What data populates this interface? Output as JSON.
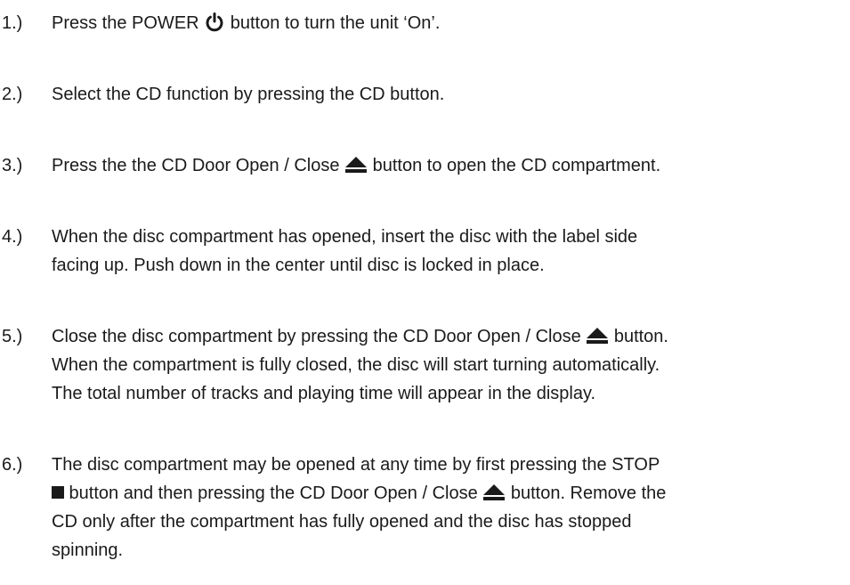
{
  "steps": [
    {
      "number": "1.)",
      "parts": [
        "Press the POWER ",
        " button to turn the unit ‘On’."
      ],
      "icon": "power-icon"
    },
    {
      "number": "2.)",
      "text": "Select the CD function by pressing the CD button."
    },
    {
      "number": "3.)",
      "parts": [
        "Press the the CD Door Open / Close ",
        " button to open the CD compartment."
      ],
      "icon": "eject-icon"
    },
    {
      "number": "4.)",
      "lines": [
        "When the disc compartment has opened, insert the disc with the label side",
        "facing up. Push down in the center until disc is locked in place."
      ]
    },
    {
      "number": "5.)",
      "line1_parts": [
        "Close the disc compartment by pressing the CD Door Open / Close ",
        " button."
      ],
      "lines": [
        "When the compartment is fully closed, the disc will start turning automatically.",
        "The total number of tracks and playing time will appear in the display."
      ],
      "icon": "eject-icon"
    },
    {
      "number": "6.)",
      "line1": "The disc compartment may be opened at any time by first pressing the STOP",
      "line2_parts": [
        " button and then pressing the CD Door Open / Close ",
        " button. Remove the"
      ],
      "line3": "CD only after the compartment has fully opened and the disc has stopped",
      "line4": "spinning.",
      "icons": [
        "stop-icon",
        "eject-icon"
      ]
    }
  ]
}
